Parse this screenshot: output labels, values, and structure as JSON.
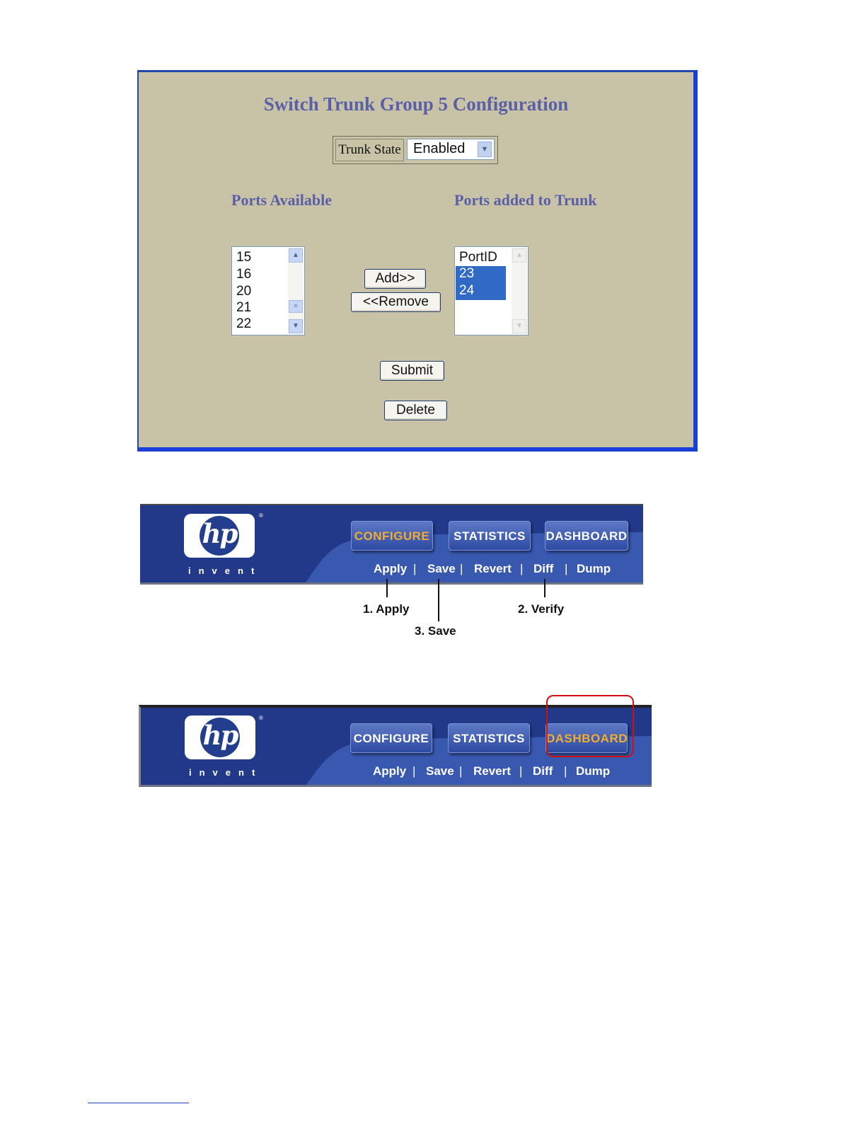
{
  "trunk_config": {
    "title": "Switch Trunk Group 5 Configuration",
    "trunk_state_label": "Trunk State",
    "trunk_state_value": "Enabled",
    "ports_available_heading": "Ports Available",
    "ports_added_heading": "Ports added to Trunk",
    "ports_available": [
      "15",
      "16",
      "20",
      "21",
      "22"
    ],
    "ports_added_header": "PortID",
    "ports_added": [
      "23",
      "24"
    ],
    "add_label": "Add>>",
    "remove_label": "<<Remove",
    "submit_label": "Submit",
    "delete_label": "Delete"
  },
  "nav_bar_1": {
    "brand_letters": "hp",
    "brand_tagline": "invent",
    "tabs": [
      "CONFIGURE",
      "STATISTICS",
      "DASHBOARD"
    ],
    "active_tab": "CONFIGURE",
    "actions": [
      "Apply",
      "Save",
      "Revert",
      "Diff",
      "Dump"
    ],
    "separator": "|"
  },
  "callouts": {
    "apply": "1. Apply",
    "verify": "2. Verify",
    "save": "3. Save"
  },
  "nav_bar_2": {
    "brand_letters": "hp",
    "brand_tagline": "invent",
    "tabs": [
      "CONFIGURE",
      "STATISTICS",
      "DASHBOARD"
    ],
    "active_tab": "DASHBOARD",
    "actions": [
      "Apply",
      "Save",
      "Revert",
      "Diff",
      "Dump"
    ],
    "separator": "|"
  },
  "colors": {
    "panel_bg": "#c8c3a6",
    "heading_text": "#5b5fa8",
    "nav_blue": "#233e8c",
    "active_tab_text": "#f2ad31",
    "highlight_red": "#d20f0f",
    "selection_blue": "#316ac5"
  }
}
